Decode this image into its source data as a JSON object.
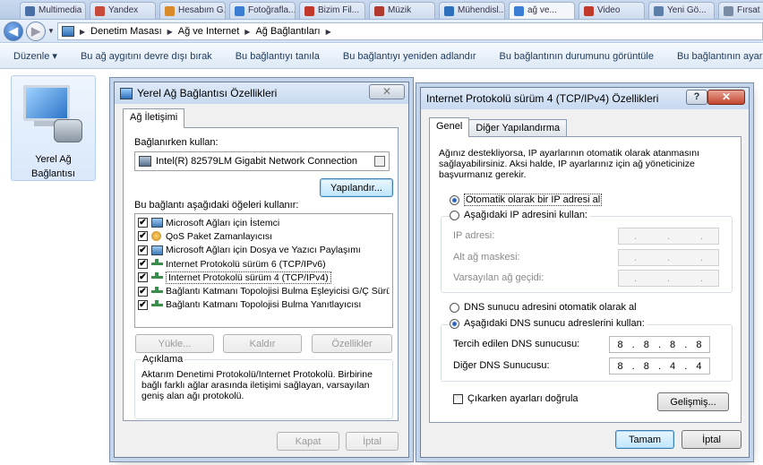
{
  "browser_tabs": [
    {
      "label": "Multimedia",
      "color": "#4a6fa5"
    },
    {
      "label": "Yandex",
      "color": "#c74a3a"
    },
    {
      "label": "Hesabım G...",
      "color": "#d98a2b"
    },
    {
      "label": "Fotoğrafla...",
      "color": "#3a7dd1"
    },
    {
      "label": "Bizim Fil...",
      "color": "#c0392b"
    },
    {
      "label": "Müzik",
      "color": "#b03a2e"
    },
    {
      "label": "Mühendisl...",
      "color": "#2c6fbd"
    },
    {
      "label": "ağ ve...",
      "color": "#3a7dd1"
    },
    {
      "label": "Video",
      "color": "#c0392b"
    },
    {
      "label": "Yeni Gö...",
      "color": "#5b7fa8"
    },
    {
      "label": "Fırsat Sep...",
      "color": "#7a8ca3"
    }
  ],
  "address": {
    "crumbs": [
      "Denetim Masası",
      "Ağ ve Internet",
      "Ağ Bağlantıları"
    ]
  },
  "commandbar": {
    "items": [
      "Düzenle ▾",
      "Bu ağ aygıtını devre dışı bırak",
      "Bu bağlantıyı tanıla",
      "Bu bağlantıyı yeniden adlandır",
      "Bu bağlantının durumunu görüntüle",
      "Bu bağlantının ayarlar"
    ]
  },
  "connection": {
    "label_line1": "Yerel Ağ",
    "label_line2": "Bağlantısı"
  },
  "left_dialog": {
    "title": "Yerel Ağ Bağlantısı Özellikleri",
    "close": "✕",
    "tab": "Ağ İletişimi",
    "connect_using_label": "Bağlanırken kullan:",
    "adapter": "Intel(R) 82579LM Gigabit Network Connection",
    "configure_button": "Yapılandır...",
    "items_label": "Bu bağlantı aşağıdaki öğeleri kullanır:",
    "items": [
      {
        "label": "Microsoft Ağları için İstemci",
        "icon": "computer-icon",
        "checked": "✔"
      },
      {
        "label": "QoS Paket Zamanlayıcısı",
        "icon": "service-icon",
        "checked": "✔"
      },
      {
        "label": "Microsoft Ağları için Dosya ve Yazıcı Paylaşımı",
        "icon": "computer-icon",
        "checked": "✔"
      },
      {
        "label": "Internet Protokolü sürüm 6 (TCP/IPv6)",
        "icon": "protocol-icon",
        "checked": "✔"
      },
      {
        "label": "Internet Protokolü sürüm 4 (TCP/IPv4)",
        "icon": "protocol-icon",
        "checked": "✔"
      },
      {
        "label": "Bağlantı Katmanı Topolojisi Bulma Eşleyicisi G/Ç Sürücü...",
        "icon": "protocol-icon",
        "checked": "✔"
      },
      {
        "label": "Bağlantı Katmanı Topolojisi Bulma Yanıtlayıcısı",
        "icon": "protocol-icon",
        "checked": "✔"
      }
    ],
    "install_button": "Yükle...",
    "uninstall_button": "Kaldır",
    "properties_button": "Özellikler",
    "description_title": "Açıklama",
    "description_text": "Aktarım Denetimi Protokolü/Internet Protokolü. Birbirine bağlı farklı ağlar arasında iletişimi sağlayan, varsayılan geniş alan ağı protokolü.",
    "close_button": "Kapat",
    "cancel_button": "İptal"
  },
  "right_dialog": {
    "title": "Internet Protokolü sürüm 4 (TCP/IPv4) Özellikleri",
    "help": "?",
    "close": "✕",
    "tabs": [
      "Genel",
      "Diğer Yapılandırma"
    ],
    "intro": "Ağınız destekliyorsa, IP ayarlarının otomatik olarak atanmasını sağlayabilirsiniz. Aksi halde, IP ayarlarınız için ağ yöneticinize başvurmanız gerekir.",
    "ip_auto": "Otomatik olarak bir IP adresi al",
    "ip_manual": "Aşağıdaki IP adresini kullan:",
    "ip_address_label": "IP adresi:",
    "subnet_label": "Alt ağ maskesi:",
    "gateway_label": "Varsayılan ağ geçidi:",
    "empty_ip": [
      ".",
      ".",
      "."
    ],
    "dns_auto": "DNS sunucu adresini otomatik olarak al",
    "dns_manual": "Aşağıdaki DNS sunucu adreslerini kullan:",
    "preferred_dns_label": "Tercih edilen DNS sunucusu:",
    "alternate_dns_label": "Diğer DNS Sunucusu:",
    "preferred_dns": [
      "8",
      "8",
      "8",
      "8"
    ],
    "alternate_dns": [
      "8",
      "8",
      "4",
      "4"
    ],
    "validate_label": "Çıkarken ayarları doğrula",
    "advanced_button": "Gelişmiş...",
    "ok_button": "Tamam",
    "cancel_button": "İptal"
  }
}
